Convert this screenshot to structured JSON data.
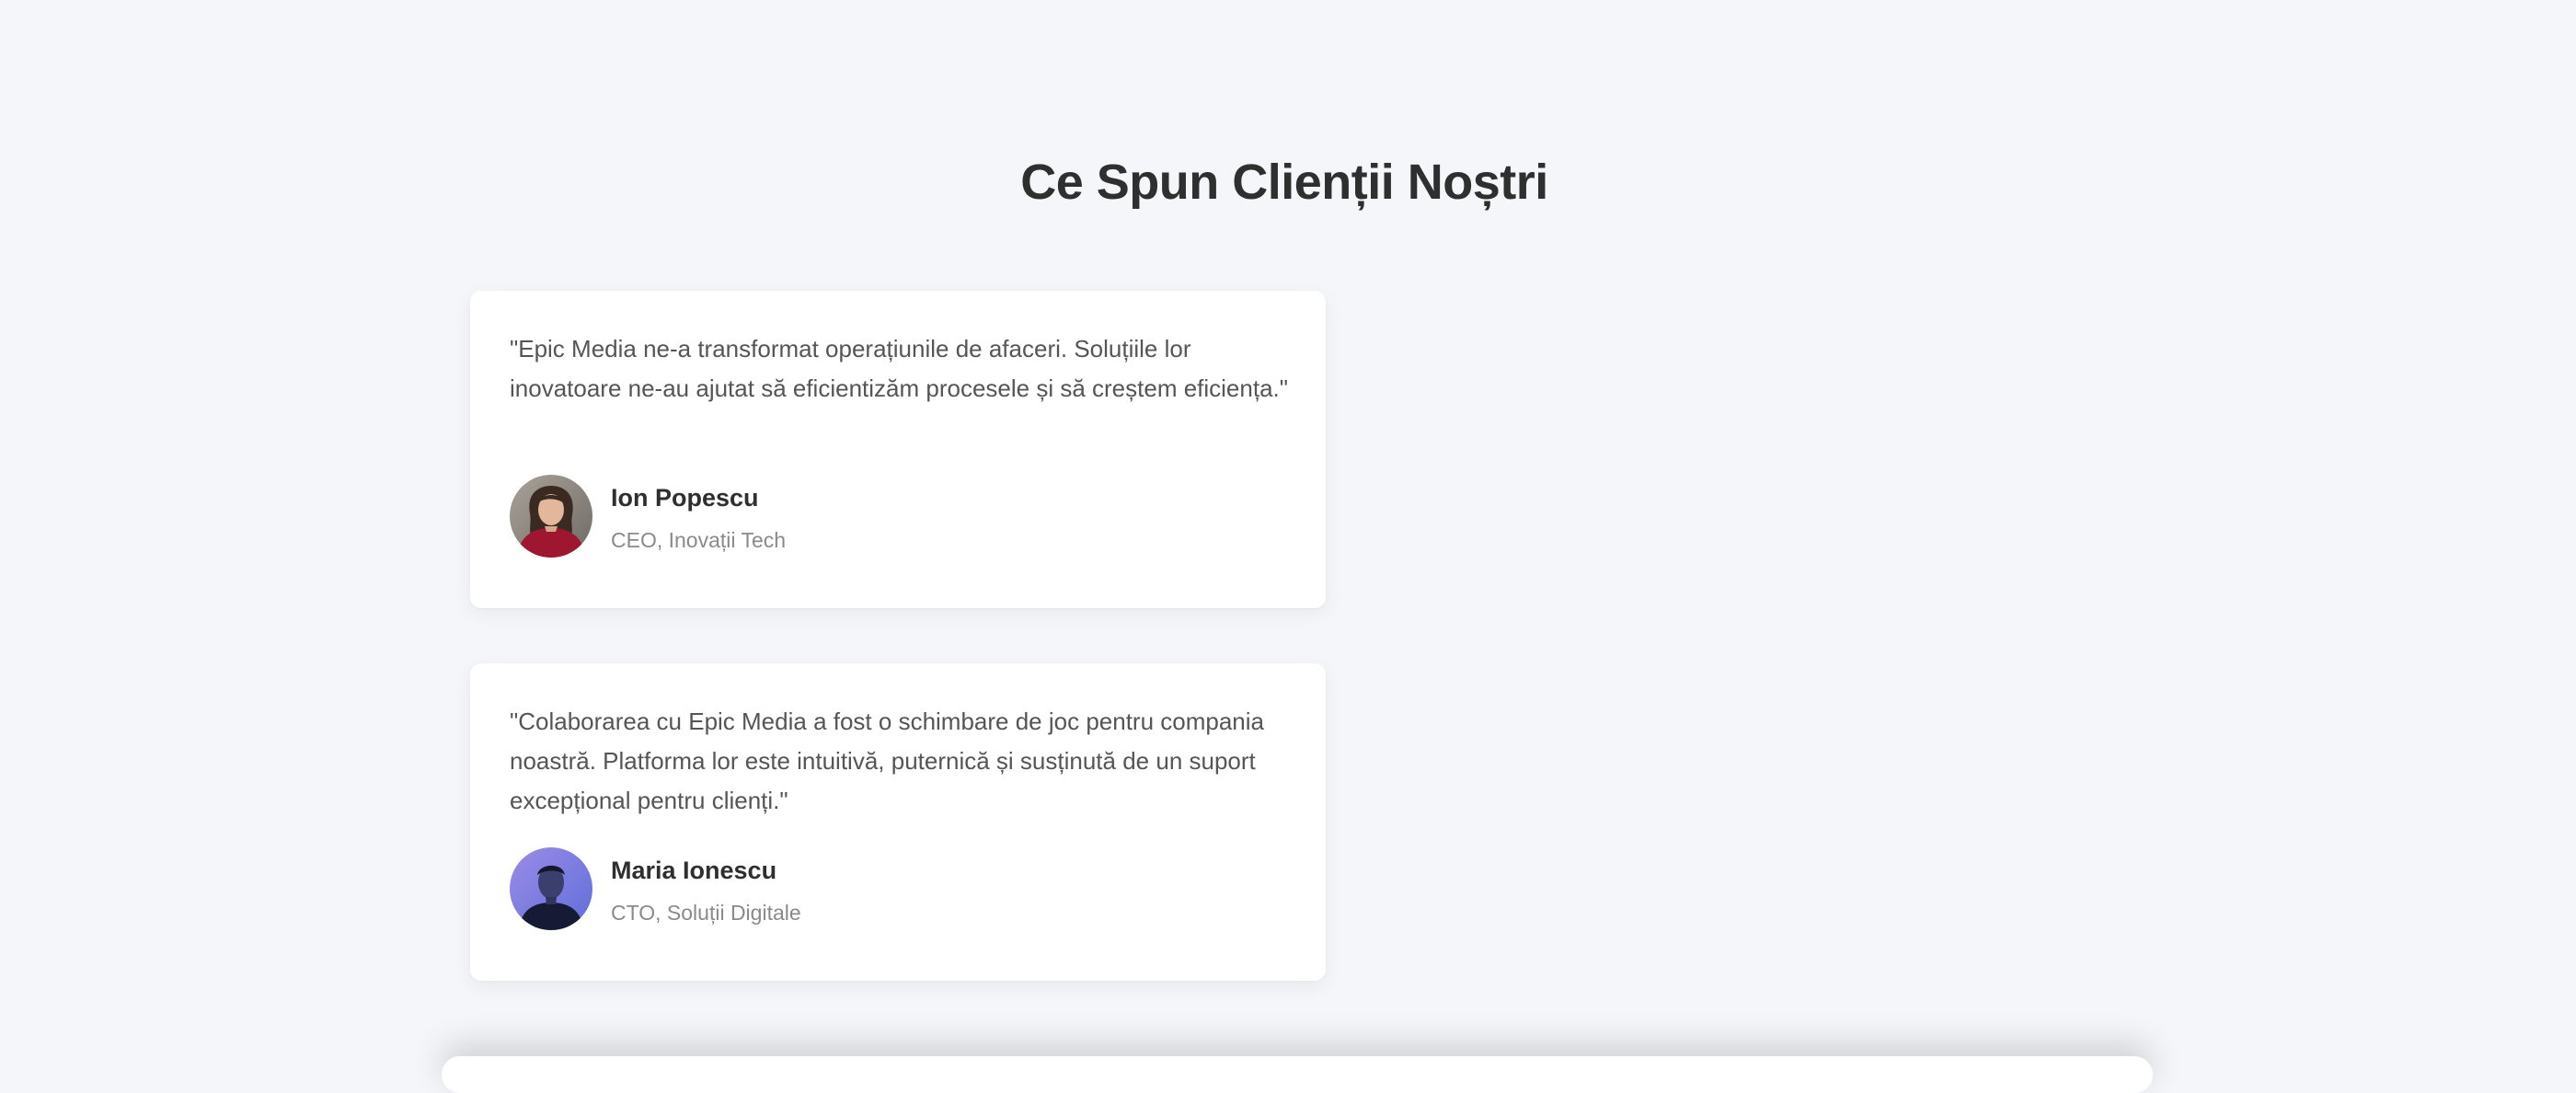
{
  "section": {
    "title": "Ce Spun Clienții Noștri"
  },
  "testimonials": [
    {
      "quote": "\"Epic Media ne-a transformat operațiunile de afaceri. Soluțiile lor inovatoare ne-au ajutat să eficientizăm procesele și să creștem eficiența.\"",
      "name": "Ion Popescu",
      "role": "CEO, Inovații Tech",
      "avatar_icon": "avatar-photo-woman-red-sweater"
    },
    {
      "quote": "\"Colaborarea cu Epic Media a fost o schimbare de joc pentru compania noastră. Platforma lor este intuitivă, puternică și susținută de un suport excepțional pentru clienți.\"",
      "name": "Maria Ionescu",
      "role": "CTO, Soluții Digitale",
      "avatar_icon": "avatar-photo-man-purple-light"
    }
  ],
  "colors": {
    "background": "#f5f6f9",
    "card": "#ffffff",
    "title": "#2f2f2f",
    "quote_text": "#555555",
    "role_text": "#8a8a8a"
  }
}
